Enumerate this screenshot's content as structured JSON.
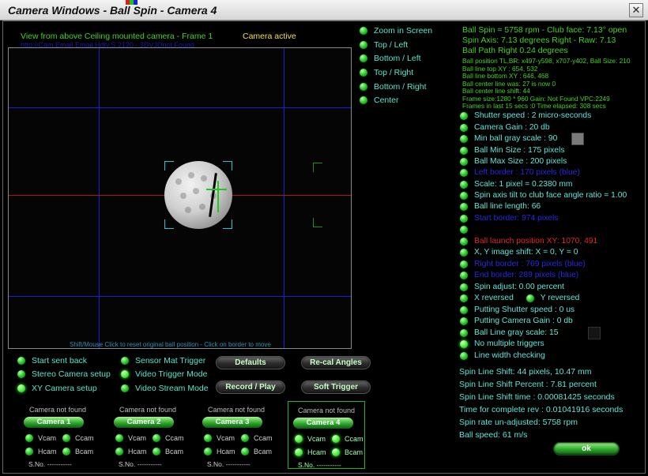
{
  "window": {
    "title": "Camera Windows - Ball Spin - Camera 4",
    "close_icon": "close-icon"
  },
  "camera_view": {
    "title": "View from above Ceiling mounted camera - Frame 1",
    "url": "http://Cam.Email.Email.Hdtv.S.2120 - 3DVJDnot.Found",
    "status": "Camera active",
    "hint": "Shift/Mouse Click to reset original ball position - Click on border to move"
  },
  "zoom_options": [
    {
      "label": "Zoom in Screen"
    },
    {
      "label": "Top / Left"
    },
    {
      "label": "Bottom / Left"
    },
    {
      "label": "Top / Right"
    },
    {
      "label": "Bottom / Right"
    },
    {
      "label": "Center"
    }
  ],
  "summary": {
    "line1": "Ball Spin = 5758 rpm - Club face: 7.13° open",
    "line2": "Spin Axis: 7.13 degrees Right - Raw: 7.13",
    "line3": "Ball Path Right 0.24 degrees"
  },
  "details": [
    "Ball position TL,BR: x497-y598, x707-y402, Ball Size: 210",
    "Ball line top XY : 654, 532",
    "Ball line bottom XY : 646, 468",
    "Ball center line was: 27 is now 0",
    "Ball center line shift: 44",
    "Frame size:1280 * 960 Gain: Not Found VPC:2249",
    "Frames in last 15 secs :0 Time elapsed: 308 secs"
  ],
  "settings": [
    {
      "text": "Shutter speed : 2 micro-seconds",
      "color": "cyan",
      "led": true
    },
    {
      "text": "Camera Gain : 20 db",
      "color": "cyan",
      "led": true
    },
    {
      "text": "Min ball gray scale : 90",
      "color": "cyan",
      "led": true,
      "swatch": "gray"
    },
    {
      "text": "Ball Min Size : 175 pixels",
      "color": "cyan",
      "led": true
    },
    {
      "text": "Ball Max Size : 200 pixels",
      "color": "cyan",
      "led": true
    },
    {
      "text": "Left border : 170 pixels (blue)",
      "color": "blue",
      "led": true
    },
    {
      "text": "Scale: 1 pixel = 0.2380 mm",
      "color": "cyan",
      "led": true
    },
    {
      "text": "Spin axis tilt to club face angle ratio = 1.00",
      "color": "cyan",
      "led": true
    },
    {
      "text": "Ball line length: 66",
      "color": "cyan",
      "led": true
    },
    {
      "text": "Start border: 974 pixels",
      "color": "blue",
      "led": true
    },
    {
      "text": "",
      "color": "cyan",
      "led": true
    },
    {
      "text": "Ball launch position XY: 1070, 491",
      "color": "red",
      "led": true
    },
    {
      "text": "X, Y image shift: X = 0, Y = 0",
      "color": "cyan",
      "led": true
    },
    {
      "text": "Right border : 769 pixels (blue)",
      "color": "blue",
      "led": true
    },
    {
      "text": "End border: 289 pixels (blue)",
      "color": "blue",
      "led": true
    },
    {
      "text": "Spin adjust: 0.00 percent",
      "color": "cyan",
      "led": true
    },
    {
      "text": "X reversed",
      "color": "cyan",
      "led": true,
      "extra": "Y reversed"
    },
    {
      "text": "Putting Shutter speed : 0 us",
      "color": "cyan",
      "led": true
    },
    {
      "text": "Putting Camera Gain : 0 db",
      "color": "cyan",
      "led": true
    },
    {
      "text": "Ball Line gray scale: 15",
      "color": "cyan",
      "led": true,
      "swatch": "dark"
    },
    {
      "text": "No multiple triggers",
      "color": "cyan",
      "led": true,
      "on": true
    },
    {
      "text": "Line width checking",
      "color": "cyan",
      "led": true
    }
  ],
  "stats": [
    "Spin Line Shift: 44 pixels, 10.47 mm",
    "Spin Line Shift Percent : 7.81 percent",
    "Spin Line Shift time : 0.00081425 seconds",
    "Time for complete rev : 0.01041916 seconds",
    "Spin rate un-adjusted: 5758 rpm",
    "Ball speed: 61 m/s"
  ],
  "left_options": [
    {
      "label": "Start sent back"
    },
    {
      "label": "Stereo Camera setup"
    },
    {
      "label": "XY Camera setup",
      "on": true
    }
  ],
  "mid_options": [
    {
      "label": "Sensor Mat Trigger"
    },
    {
      "label": "Video Trigger Mode",
      "on": true
    },
    {
      "label": "Video Stream Mode"
    }
  ],
  "buttons": {
    "defaults": "Defaults",
    "recal": "Re-cal Angles",
    "record": "Record / Play",
    "soft_trigger": "Soft Trigger",
    "ok": "ok"
  },
  "cameras": [
    {
      "status": "Camera not found",
      "label": "Camera 1",
      "vcam": "Vcam",
      "ccam": "Ccam",
      "hcam": "Hcam",
      "bcam": "Bcam",
      "sno": "S.No. -----------"
    },
    {
      "status": "Camera not found",
      "label": "Camera 2",
      "vcam": "Vcam",
      "ccam": "Ccam",
      "hcam": "Hcam",
      "bcam": "Bcam",
      "sno": "S.No. -----------"
    },
    {
      "status": "Camera not found",
      "label": "Camera 3",
      "vcam": "Vcam",
      "ccam": "Ccam",
      "hcam": "Hcam",
      "bcam": "Bcam",
      "sno": "S.No. -----------"
    },
    {
      "status": "Camera not found",
      "label": "Camera 4",
      "vcam": "Vcam",
      "ccam": "Ccam",
      "hcam": "Hcam",
      "bcam": "Bcam",
      "sno": "S.No. -----------"
    }
  ],
  "colors": {
    "accent_green": "#46d21c",
    "label_cyan": "#5ee6d8",
    "border_blue": "#2828e0",
    "launch_red": "#e02828"
  }
}
